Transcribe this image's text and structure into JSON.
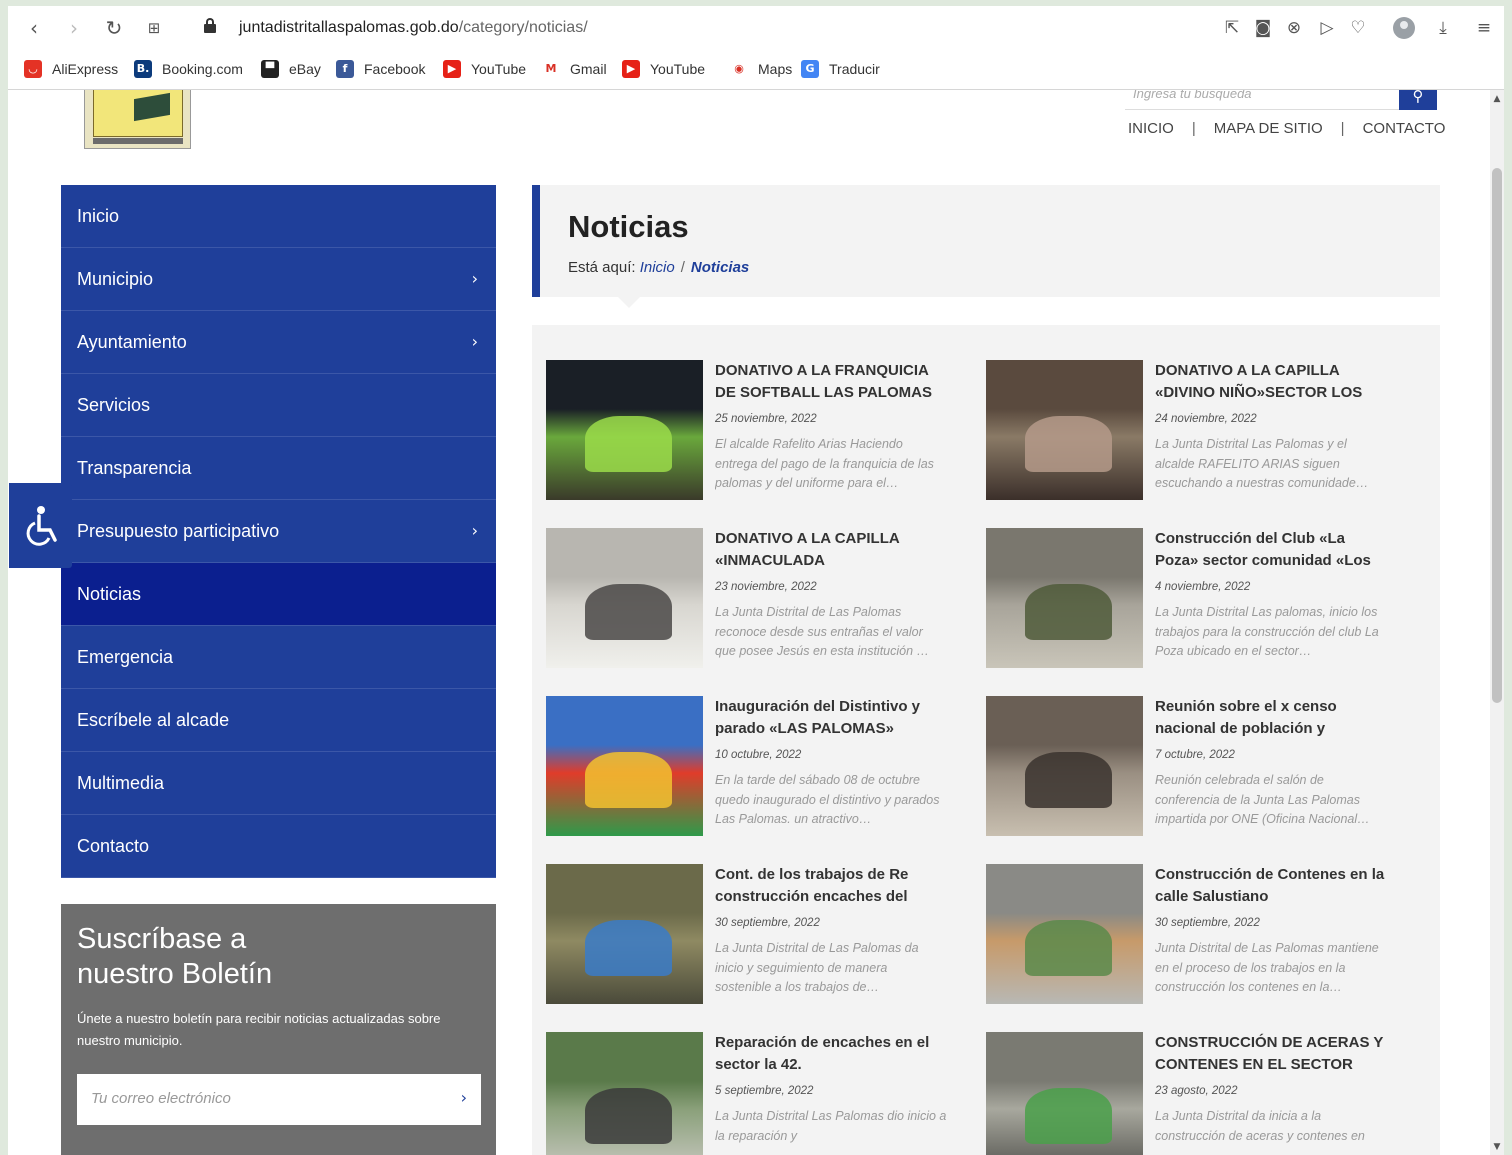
{
  "browser": {
    "url_host": "juntadistritallaspalomas.gob.do",
    "url_path": "/category/noticias/",
    "bookmarks": [
      {
        "label": "AliExpress",
        "color": "#e43225",
        "glyph": "◡"
      },
      {
        "label": "Booking.com",
        "color": "#0c3b7c",
        "glyph": "B."
      },
      {
        "label": "eBay",
        "color": "#222222",
        "glyph": "▀"
      },
      {
        "label": "Facebook",
        "color": "#3b5998",
        "glyph": "f"
      },
      {
        "label": "YouTube",
        "color": "#e62117",
        "glyph": "▶"
      },
      {
        "label": "Gmail",
        "color": "#ffffff",
        "glyph": "M"
      },
      {
        "label": "YouTube",
        "color": "#e62117",
        "glyph": "▶"
      },
      {
        "label": "Maps",
        "color": "#ffffff",
        "glyph": "◉"
      },
      {
        "label": "Traducir",
        "color": "#4285f4",
        "glyph": "G"
      }
    ]
  },
  "header": {
    "search_placeholder": "Ingresa tu búsqueda",
    "nav": [
      "INICIO",
      "MAPA DE SITIO",
      "CONTACTO"
    ]
  },
  "sidebar": {
    "items": [
      {
        "label": "Inicio",
        "submenu": false
      },
      {
        "label": "Municipio",
        "submenu": true
      },
      {
        "label": "Ayuntamiento",
        "submenu": true
      },
      {
        "label": "Servicios",
        "submenu": false
      },
      {
        "label": "Transparencia",
        "submenu": false
      },
      {
        "label": "Presupuesto participativo",
        "submenu": true
      },
      {
        "label": "Noticias",
        "submenu": false,
        "active": true
      },
      {
        "label": "Emergencia",
        "submenu": false
      },
      {
        "label": "Escríbele al alcade",
        "submenu": false
      },
      {
        "label": "Multimedia",
        "submenu": false
      },
      {
        "label": "Contacto",
        "submenu": false
      }
    ]
  },
  "newsletter": {
    "title": "Suscríbase a nuestro Boletín",
    "description": "Únete a nuestro boletín para recibir noticias actualizadas sobre nuestro municipio.",
    "email_placeholder": "Tu correo electrónico"
  },
  "main": {
    "title": "Noticias",
    "breadcrumb_prefix": "Está aquí:",
    "breadcrumb_home": "Inicio",
    "breadcrumb_sep": "/",
    "breadcrumb_current": "Noticias"
  },
  "news": [
    {
      "title": "DONATIVO A LA FRANQUICIA DE SOFTBALL LAS PALOMAS",
      "date": "25 noviembre, 2022",
      "excerpt": "El alcalde Rafelito Arias Haciendo entrega del pago de la franquicia de las palomas y del uniforme para el…",
      "colors": [
        "#1a1f26",
        "#6aa83c",
        "#9bdc4a",
        "#3a3a2a"
      ]
    },
    {
      "title": "DONATIVO A LA CAPILLA «DIVINO NIÑO»SECTOR LOS",
      "date": "24 noviembre, 2022",
      "excerpt": "La Junta Distrital Las Palomas y el alcalde RAFELITO ARIAS siguen escuchando a nuestras comunidade…",
      "colors": [
        "#5a4a3e",
        "#8a7a66",
        "#b59a8a",
        "#3b2f2a"
      ]
    },
    {
      "title": "DONATIVO A LA CAPILLA «INMACULADA",
      "date": "23 noviembre, 2022",
      "excerpt": "La Junta Distrital de Las Palomas reconoce desde sus entrañas el valor que posee Jesús en esta institución …",
      "colors": [
        "#b8b6b0",
        "#d8d6d0",
        "#4a4846",
        "#f0f0ec"
      ]
    },
    {
      "title": "Construcción del Club «La Poza» sector comunidad «Los",
      "date": "4 noviembre, 2022",
      "excerpt": " La Junta Distrital Las palomas, inicio los trabajos para la construcción del club La Poza ubicado en el sector…",
      "colors": [
        "#7a776e",
        "#a8a49a",
        "#4f5a3a",
        "#c9c5b9"
      ]
    },
    {
      "title": "Inauguración del Distintivo y parado «LAS PALOMAS»",
      "date": "10 octubre, 2022",
      "excerpt": "En la tarde del sábado 08 de octubre quedo inaugurado el distintivo y parados Las Palomas. un atractivo…",
      "colors": [
        "#3a6fc4",
        "#e03c2a",
        "#f2c230",
        "#2e9a4a"
      ]
    },
    {
      "title": "Reunión sobre el x censo nacional de población y",
      "date": "7 octubre, 2022",
      "excerpt": "Reunión celebrada el salón de conferencia de la Junta Las Palomas impartida por ONE (Oficina Nacional…",
      "colors": [
        "#6a5f55",
        "#9a8f82",
        "#3a332e",
        "#c8bfb0"
      ]
    },
    {
      "title": "Cont. de los trabajos de Re construcción encaches del",
      "date": "30 septiembre, 2022",
      "excerpt": "La Junta Distrital de Las Palomas da inicio y seguimiento de manera sostenible a los trabajos de…",
      "colors": [
        "#6b6a4a",
        "#8f8a62",
        "#3a7bc8",
        "#4a4a3a"
      ]
    },
    {
      "title": "Construcción de Contenes en la calle Salustiano",
      "date": "30 septiembre, 2022",
      "excerpt": "Junta Distrital de Las Palomas mantiene en el proceso de los trabajos en la construcción los contenes en la…",
      "colors": [
        "#8a8a86",
        "#c79a6a",
        "#5a8a4a",
        "#b8b8b4"
      ]
    },
    {
      "title": "Reparación de encaches en el sector la 42.",
      "date": "5 septiembre, 2022",
      "excerpt": "La Junta Distrital Las Palomas dio inicio a la reparación y",
      "colors": [
        "#5a7a4a",
        "#8aa07a",
        "#3a3a3a",
        "#c8c8c0"
      ]
    },
    {
      "title": "CONSTRUCCIÓN DE ACERAS Y CONTENES EN EL SECTOR DON",
      "date": "23 agosto, 2022",
      "excerpt": "La Junta Distrital da inicia a la construcción de aceras y contenes en",
      "colors": [
        "#7a7a72",
        "#a8a89e",
        "#4aa04a",
        "#555550"
      ]
    }
  ]
}
